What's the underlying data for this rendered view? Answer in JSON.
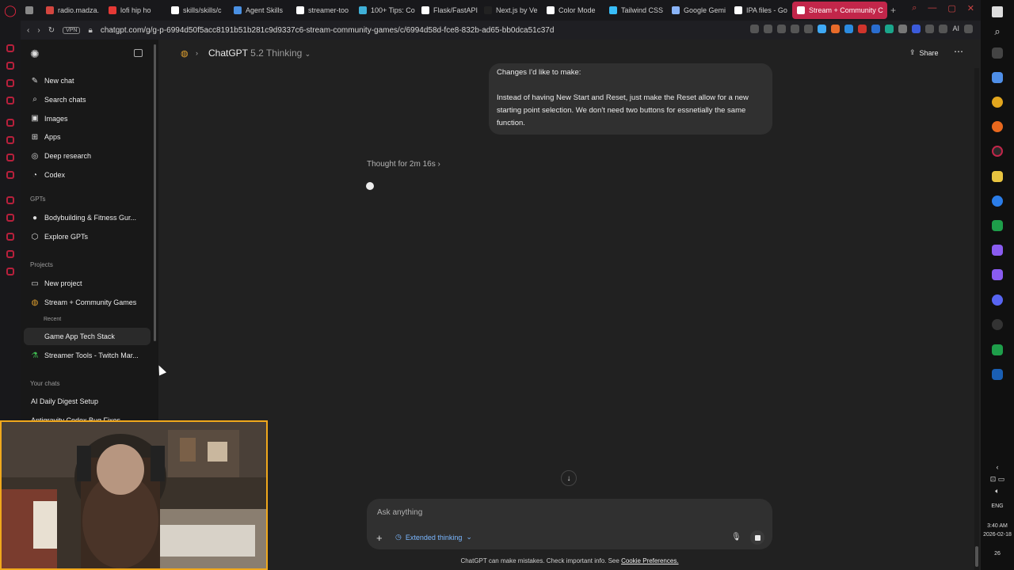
{
  "browser": {
    "tabs": [
      {
        "label": "",
        "color": "#888888"
      },
      {
        "label": "radio.madza.",
        "color": "#d4463f"
      },
      {
        "label": "lofi hip ho",
        "color": "#e53935"
      },
      {
        "label": "skills/skills/c",
        "color": "#ffffff"
      },
      {
        "label": "Agent Skills",
        "color": "#4a90e2"
      },
      {
        "label": "streamer-too",
        "color": "#ffffff"
      },
      {
        "label": "100+ Tips: Co",
        "color": "#3fb0d7"
      },
      {
        "label": "Flask/FastAPI",
        "color": "#ffffff"
      },
      {
        "label": "Next.js by Ve",
        "color": "#222222"
      },
      {
        "label": "Color Mode",
        "color": "#ffffff"
      },
      {
        "label": "Tailwind CSS",
        "color": "#38bdf8"
      },
      {
        "label": "Google Gemi",
        "color": "#8ab4f8"
      },
      {
        "label": "IPA files - Go",
        "color": "#ffffff"
      },
      {
        "label": "Stream + Community C",
        "color": "#ffffff"
      }
    ],
    "url": "chatgpt.com/g/g-p-6994d50f5acc8191b51b281c9d9337c6-stream-community-games/c/6994d58d-fce8-832b-ad65-bb0dca51c37d",
    "vpn_label": "VPN",
    "ai_label": "AI"
  },
  "sidebar": {
    "items": [
      {
        "label": "New chat",
        "icon": "new-chat-icon",
        "glyph": "✎"
      },
      {
        "label": "Search chats",
        "icon": "search-icon",
        "glyph": "⌕"
      },
      {
        "label": "Images",
        "icon": "images-icon",
        "glyph": "▣"
      },
      {
        "label": "Apps",
        "icon": "apps-icon",
        "glyph": "⊞"
      },
      {
        "label": "Deep research",
        "icon": "deep-research-icon",
        "glyph": "◎"
      },
      {
        "label": "Codex",
        "icon": "codex-icon",
        "glyph": "◔"
      }
    ],
    "gpts_heading": "GPTs",
    "gpts": [
      {
        "label": "Bodybuilding & Fitness Gur...",
        "icon": "gpt-avatar-icon",
        "glyph": "●"
      },
      {
        "label": "Explore GPTs",
        "icon": "explore-icon",
        "glyph": "⬡"
      }
    ],
    "projects_heading": "Projects",
    "projects": [
      {
        "label": "New project",
        "icon": "new-project-icon",
        "glyph": "▭"
      },
      {
        "label": "Stream + Community Games",
        "icon": "globe-icon",
        "glyph": "◍"
      }
    ],
    "recent_heading": "Recent",
    "recent": [
      {
        "label": "Game App Tech Stack"
      },
      {
        "label": "Streamer Tools - Twitch Mar...",
        "icon": "flask-icon",
        "glyph": "⚗"
      }
    ],
    "your_chats_heading": "Your chats",
    "chats": [
      {
        "label": "AI Daily Digest Setup"
      },
      {
        "label": "Antigravity Codex Bug Fixes"
      }
    ]
  },
  "header": {
    "model": "ChatGPT",
    "version": "5.2 Thinking",
    "share_label": "Share"
  },
  "conversation": {
    "user_message_intro": "Changes I'd like to make:",
    "user_message_body": "Instead of having New Start and Reset, just make the Reset allow for a new starting point selection. We don't need two buttons for essnetially the same function.",
    "thought_label": "Thought for 2m 16s"
  },
  "composer": {
    "placeholder": "Ask anything",
    "mode_label": "Extended thinking"
  },
  "footer": {
    "disclaimer": "ChatGPT can make mistakes. Check important info. See",
    "link": "Cookie Preferences."
  },
  "taskbar": {
    "language": "ENG",
    "time": "3:40 AM",
    "date": "2026-02-18",
    "notif_count": "26"
  }
}
